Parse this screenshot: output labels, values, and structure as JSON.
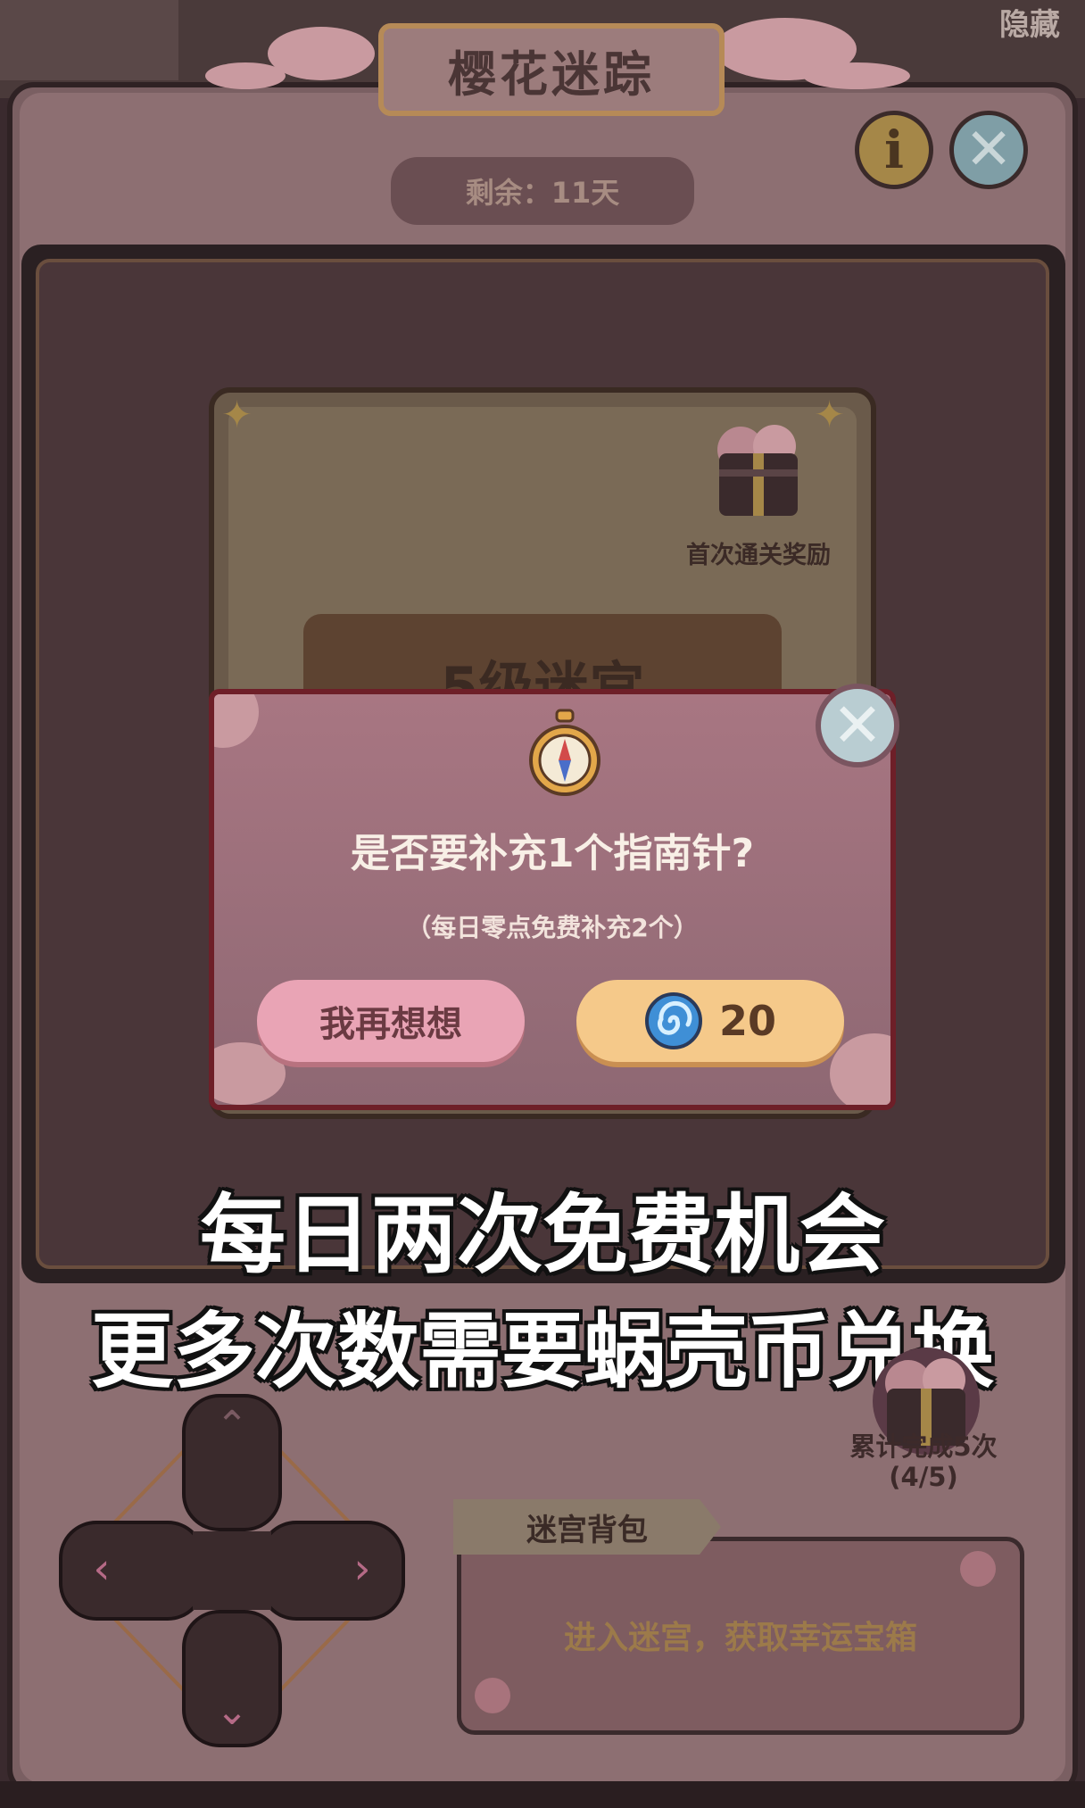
{
  "header": {
    "title": "樱花迷踪",
    "corner_label": "隐藏",
    "remaining": "剩余：11天"
  },
  "buttons": {
    "info_icon": "info-icon",
    "close_icon": "close-icon"
  },
  "level_card": {
    "first_clear_reward": "首次通关奖励",
    "level_label": "5级迷宫"
  },
  "dialog": {
    "title": "是否要补充1个指南针?",
    "note": "（每日零点免费补充2个）",
    "cancel_label": "我再想想",
    "price": "20",
    "currency_icon": "snail-shell-coin-icon"
  },
  "subtitles": {
    "line1": "每日两次免费机会",
    "line2": "更多次数需要蜗壳币兑换"
  },
  "cumulative_reward": {
    "label": "累计完成5次",
    "progress": "(4/5)"
  },
  "backpack": {
    "tab": "迷宫背包",
    "empty_text": "进入迷宫，获取幸运宝箱"
  },
  "colors": {
    "dialog_border": "#6e1f28",
    "cancel_button": "#e9a4b5",
    "buy_button": "#f5c98a"
  }
}
